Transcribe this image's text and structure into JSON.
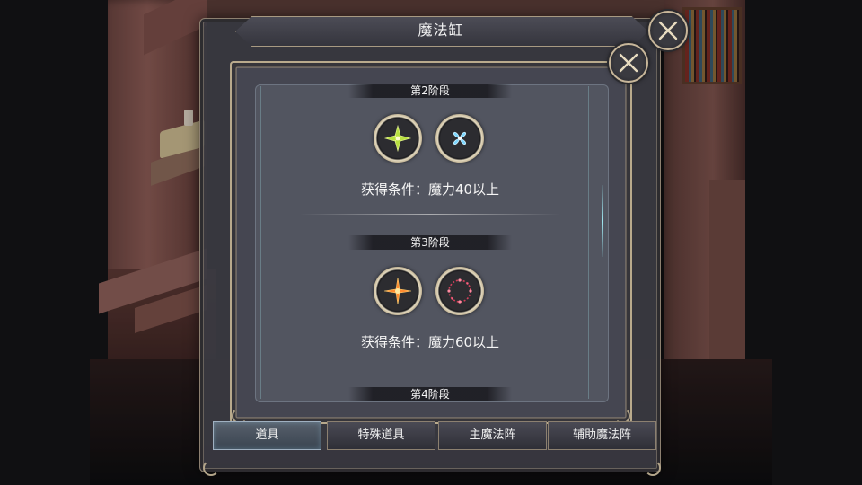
{
  "outer_window": {
    "title": "魔法缸"
  },
  "stages": [
    {
      "label": "第2阶段",
      "condition": "获得条件：魔力40以上",
      "icons": [
        "green-star-crystal-icon",
        "blue-flower-crystal-icon"
      ]
    },
    {
      "label": "第3阶段",
      "condition": "获得条件：魔力60以上",
      "icons": [
        "orange-spark-crystal-icon",
        "red-ring-crystal-icon"
      ]
    },
    {
      "label": "第4阶段"
    }
  ],
  "tabs": [
    {
      "label": "道具",
      "active": true
    },
    {
      "label": "特殊道具",
      "active": false
    },
    {
      "label": "主魔法阵",
      "active": false
    },
    {
      "label": "辅助魔法阵",
      "active": false
    }
  ],
  "colors": {
    "panel": "#3a3a42",
    "frame": "#b9aa8c",
    "active_tab": "#3a4450",
    "scroll_highlight": "#9fe6f0"
  }
}
